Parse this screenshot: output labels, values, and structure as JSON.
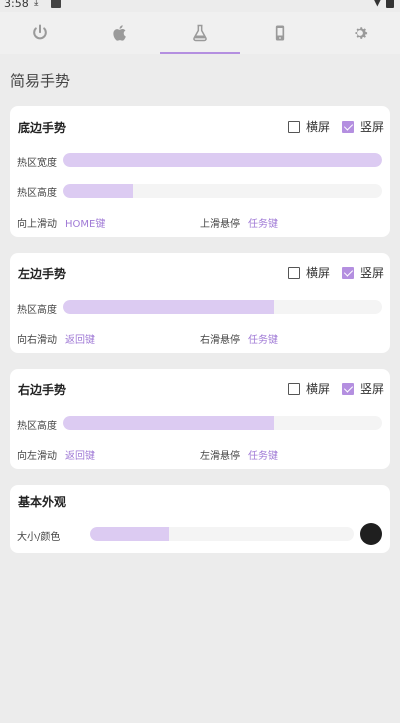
{
  "status_bar": {
    "time": "3:58"
  },
  "tabs": [
    {
      "icon": "power-icon"
    },
    {
      "icon": "apple-icon"
    },
    {
      "icon": "flask-icon",
      "active": true
    },
    {
      "icon": "phone-icon"
    },
    {
      "icon": "gear-icon"
    }
  ],
  "section_title": "简易手势",
  "bottom": {
    "title": "底边手势",
    "landscape": {
      "label": "横屏",
      "checked": false
    },
    "portrait": {
      "label": "竖屏",
      "checked": true
    },
    "width_label": "热区宽度",
    "width_value": 1.0,
    "height_label": "热区高度",
    "height_value": 0.22,
    "swipe_label": "向上滑动",
    "swipe_value": "HOME键",
    "hover_label": "上滑悬停",
    "hover_value": "任务键"
  },
  "left": {
    "title": "左边手势",
    "landscape": {
      "label": "横屏",
      "checked": false
    },
    "portrait": {
      "label": "竖屏",
      "checked": true
    },
    "height_label": "热区高度",
    "height_value": 0.66,
    "swipe_label": "向右滑动",
    "swipe_value": "返回键",
    "hover_label": "右滑悬停",
    "hover_value": "任务键"
  },
  "right": {
    "title": "右边手势",
    "landscape": {
      "label": "横屏",
      "checked": false
    },
    "portrait": {
      "label": "竖屏",
      "checked": true
    },
    "height_label": "热区高度",
    "height_value": 0.66,
    "swipe_label": "向左滑动",
    "swipe_value": "返回键",
    "hover_label": "左滑悬停",
    "hover_value": "任务键"
  },
  "appearance": {
    "title": "基本外观",
    "size_color_label": "大小/颜色",
    "size_value": 0.3,
    "color": "#1f1f1f"
  },
  "colors": {
    "accent": "#b48fe0",
    "slider_fill": "#dccbf2",
    "link": "#a07ad6"
  }
}
